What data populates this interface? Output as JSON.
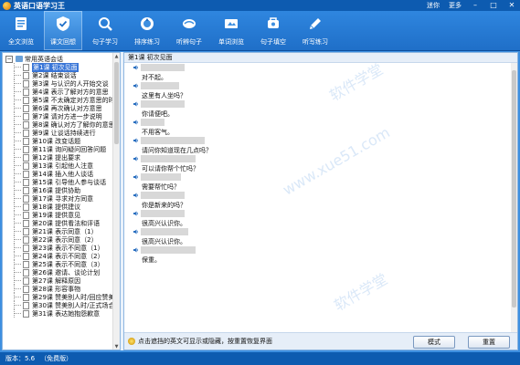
{
  "window": {
    "title": "英语口语学习王",
    "right_links": [
      "迷你",
      "更多"
    ],
    "controls": [
      "minimize",
      "maximize",
      "close"
    ]
  },
  "toolbar": [
    {
      "label": "全文浏览",
      "icon": "document-icon",
      "active": false
    },
    {
      "label": "课文回想",
      "icon": "shield-check-icon",
      "active": true
    },
    {
      "label": "句子学习",
      "icon": "magnifier-icon",
      "active": false
    },
    {
      "label": "排序练习",
      "icon": "sort-icon",
      "active": false
    },
    {
      "label": "听辨句子",
      "icon": "listen-icon",
      "active": false
    },
    {
      "label": "单词浏览",
      "icon": "words-icon",
      "active": false
    },
    {
      "label": "句子填空",
      "icon": "fill-blank-icon",
      "active": false
    },
    {
      "label": "听写练习",
      "icon": "dictation-icon",
      "active": false
    }
  ],
  "tree": {
    "root": "常用英语会话",
    "items": [
      "第1课 初次见面",
      "第2课 结束谈话",
      "第3课 与认识的人开始交谈",
      "第4课 表示了解对方的意思",
      "第5课 不太确定对方意思的时",
      "第6课 再次确认对方意思",
      "第7课 请对方进一步说明",
      "第8课 确认对方了解你的意思",
      "第9课 让谈话持续进行",
      "第10课 改变话题",
      "第11课 询问疑问回答问题",
      "第12课 提出要求",
      "第13课 引起他人注意",
      "第14课 插入他人谈话",
      "第15课 引导他人参与谈话",
      "第16课 提供协助",
      "第17课 寻求对方同意",
      "第18课 提供建议",
      "第19课 提供意见",
      "第20课 提供看法和评语",
      "第21课 表示同意（1）",
      "第22课 表示同意（2）",
      "第23课 表示不同意（1）",
      "第24课 表示不同意（2）",
      "第25课 表示不同意（3）",
      "第26课 邀请、谈论计划",
      "第27课 解释原因",
      "第28课 形容事物",
      "第29课 赞美别人时/回应赞美",
      "第30课 赞美别人时/正式场合",
      "第31课 表达她抱怨歉意"
    ],
    "selected_index": 0
  },
  "content": {
    "lesson_title": "第1课 初次见面",
    "sentences": [
      {
        "cn": "对不起。"
      },
      {
        "cn": "这里有人坐吗？"
      },
      {
        "cn": "你请便吧。"
      },
      {
        "cn": "不用客气。"
      },
      {
        "cn": "请问你知道现在几点吗？"
      },
      {
        "cn": "可以请你帮个忙吗？"
      },
      {
        "cn": "需要帮忙吗？"
      },
      {
        "cn": "你是新来的吗？"
      },
      {
        "cn": "很高兴认识你。"
      },
      {
        "cn": "很高兴认识你。"
      },
      {
        "cn": "保重。"
      }
    ],
    "hint": "点击遮挡的英文可显示或隐藏，按重置恢复界面",
    "mode_button": "模式",
    "reset_button": "重置"
  },
  "status": {
    "version": "版本：5.6",
    "license": "（免费版）"
  },
  "watermark": [
    "软件学堂",
    "www.xue51.com"
  ],
  "colors": {
    "titlebar": "#0d5bb0",
    "toolbar": "#2f86df",
    "selection": "#3875d7"
  }
}
